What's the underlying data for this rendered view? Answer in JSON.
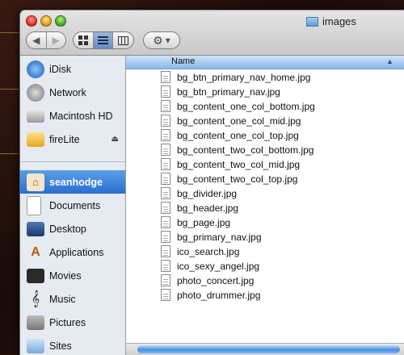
{
  "window": {
    "title": "images"
  },
  "toolbar": {
    "nav_back_label": "◀",
    "nav_forward_label": "▶",
    "view_icons": [
      "icon-view-icon",
      "list-view-icon",
      "column-view-icon"
    ],
    "action_icon": "gear-icon",
    "action_menu_arrow": "▾"
  },
  "sidebar": {
    "devices": [
      {
        "label": "iDisk",
        "icon": "idisk-icon"
      },
      {
        "label": "Network",
        "icon": "network-icon"
      },
      {
        "label": "Macintosh HD",
        "icon": "hard-disk-icon"
      },
      {
        "label": "fireLite",
        "icon": "external-disk-icon",
        "eject": "⏏"
      }
    ],
    "places": [
      {
        "label": "seanhodge",
        "icon": "home-icon",
        "selected": true
      },
      {
        "label": "Documents",
        "icon": "documents-icon"
      },
      {
        "label": "Desktop",
        "icon": "desktop-icon"
      },
      {
        "label": "Applications",
        "icon": "applications-icon"
      },
      {
        "label": "Movies",
        "icon": "movies-icon"
      },
      {
        "label": "Music",
        "icon": "music-icon"
      },
      {
        "label": "Pictures",
        "icon": "pictures-icon"
      },
      {
        "label": "Sites",
        "icon": "sites-icon"
      }
    ]
  },
  "list": {
    "column_header": "Name",
    "sort_direction": "ascending",
    "files": [
      "bg_btn_primary_nav_home.jpg",
      "bg_btn_primary_nav.jpg",
      "bg_content_one_col_bottom.jpg",
      "bg_content_one_col_mid.jpg",
      "bg_content_one_col_top.jpg",
      "bg_content_two_col_bottom.jpg",
      "bg_content_two_col_mid.jpg",
      "bg_content_two_col_top.jpg",
      "bg_divider.jpg",
      "bg_header.jpg",
      "bg_page.jpg",
      "bg_primary_nav.jpg",
      "ico_search.jpg",
      "ico_sexy_angel.jpg",
      "photo_concert.jpg",
      "photo_drummer.jpg"
    ]
  },
  "colors": {
    "selection": "#2b6ed0",
    "header": "#8ab8ec",
    "sidebar_bg": "#e6ebf2"
  }
}
